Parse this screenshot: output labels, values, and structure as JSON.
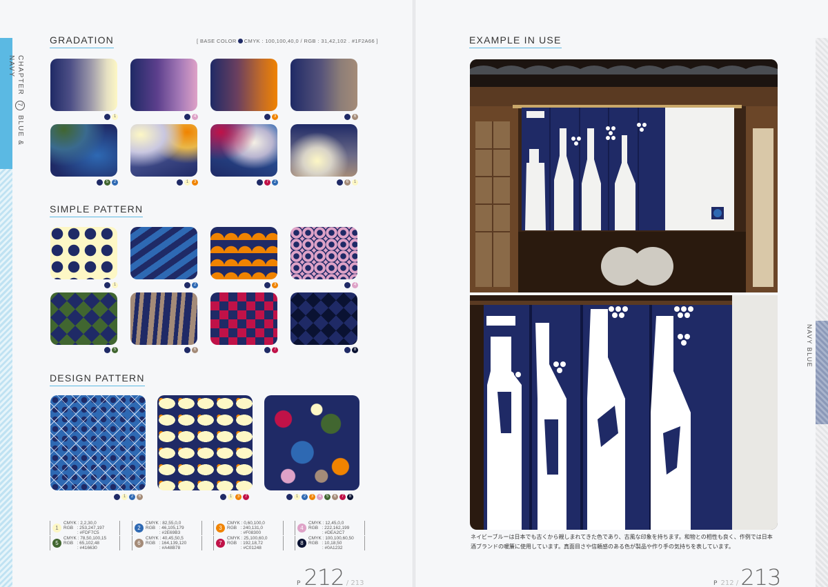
{
  "left": {
    "chapter": {
      "prefix": "CHAPTER",
      "number": "7",
      "name": "BLUE & NAVY"
    },
    "gradation": {
      "title": "GRADATION",
      "base_color_label": "[ BASE COLOR",
      "base_color_values": "CMYK : 100,100,40,0 / RGB : 31,42,102 . #1F2A66 ]",
      "swatch_dots": [
        [
          "1"
        ],
        [
          "4"
        ],
        [
          "3"
        ],
        [
          "6"
        ],
        [
          "5",
          "2"
        ],
        [
          "1",
          "3"
        ],
        [
          "7",
          "2"
        ],
        [
          "6",
          "1"
        ]
      ]
    },
    "simple_pattern": {
      "title": "SIMPLE PATTERN",
      "swatch_dots": [
        [
          "1"
        ],
        [
          "2"
        ],
        [
          "3"
        ],
        [
          "4"
        ],
        [
          "5"
        ],
        [
          "6"
        ],
        [
          "7"
        ],
        [
          "8"
        ]
      ]
    },
    "design_pattern": {
      "title": "DESIGN PATTERN",
      "swatch_dots": [
        [
          "1",
          "2",
          "6"
        ],
        [
          "1",
          "3",
          "7"
        ],
        [
          "1",
          "2",
          "3",
          "4",
          "5",
          "6",
          "7",
          "8"
        ]
      ]
    },
    "legend": [
      {
        "num": "1",
        "text": "CMYK : 2,2,30,0\nRGB   : 253,247,197\n           : #FDF7C5",
        "color": "#FDF7C5"
      },
      {
        "num": "2",
        "text": "CMYK : 82,55,0,0\nRGB   : 46,105,179\n           : #2E69B3",
        "color": "#2E69B3"
      },
      {
        "num": "3",
        "text": "CMYK : 0,60,100,0\nRGB   : 240,131,0\n           : #F08300",
        "color": "#F08300"
      },
      {
        "num": "4",
        "text": "CMYK : 12,45,0,0\nRGB   : 222,162,199\n           : #DEA2C7",
        "color": "#DEA2C7"
      },
      {
        "num": "5",
        "text": "CMYK : 78,50,100,15\nRGB   : 65,102,48\n           : #416630",
        "color": "#416630"
      },
      {
        "num": "6",
        "text": "CMYK : 40,45,50,5\nRGB   : 164,139,120\n           : #A48B78",
        "color": "#A48B78"
      },
      {
        "num": "7",
        "text": "CMYK : 25,100,60,0\nRGB   : 192,18,72\n           : #C01248",
        "color": "#C01248"
      },
      {
        "num": "8",
        "text": "CMYK : 100,100,60,50\nRGB   : 10,18,50\n           : #0A1232",
        "color": "#0A1232"
      }
    ],
    "page_number": {
      "prefix": "P",
      "current": "212",
      "other": "213"
    }
  },
  "right": {
    "title": "EXAMPLE IN USE",
    "side_label": "NAVY BLUE",
    "caption": "ネイビーブルーは日本でも古くから親しまれてきた色であり、古風な印象を持ちます。和物との相性も良く、作例では日本酒ブランドの暖簾に使用しています。真面目さや信頼感のある色が製品や作り手の気持ちを表しています。",
    "page_number": {
      "prefix": "P",
      "other": "212",
      "current": "213"
    }
  },
  "colors": {
    "base": "#1F2A66",
    "accent": "#5bb9e3",
    "c1": "#FDF7C5",
    "c2": "#2E69B3",
    "c3": "#F08300",
    "c4": "#DEA2C7",
    "c5": "#416630",
    "c6": "#A48B78",
    "c7": "#C01248",
    "c8": "#0A1232"
  }
}
